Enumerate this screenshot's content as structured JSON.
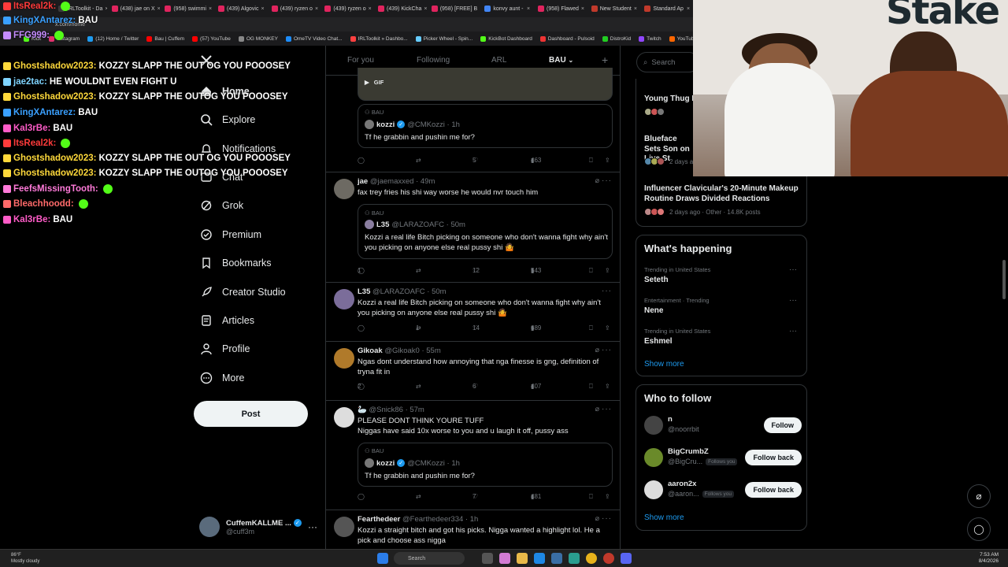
{
  "browser": {
    "tabs": [
      "IRLToolkit - Da",
      "(438) jae on X",
      "(958) swimmi",
      "(439) Algovic",
      "(439) ryzen o",
      "(439) ryzen o",
      "(439) KickCha",
      "(958) [FREE] B",
      "konvy aunt -",
      "(958) Flawed",
      "New Student",
      "Standard Ap"
    ],
    "address": "x.com/home",
    "bookmarks": [
      "Kick",
      "Instagram",
      "(12) Home / Twitter",
      "Bau | Cuffem",
      "(57) YouTube",
      "OG MONKEY",
      "OmeTV Video Chat...",
      "IRLToolkit » Dashbo...",
      "Picker Wheel - Spin...",
      "KickBot Dashboard",
      "Dashboard - Pulsoid",
      "DistroKid",
      "Twitch",
      "YouTube to WAV D..."
    ]
  },
  "chat": [
    {
      "user": "ItsReal2k:",
      "msg": "",
      "color": "#ff3b3b",
      "emote": true
    },
    {
      "user": "KingXAntarez:",
      "msg": "BAU",
      "color": "#3aa0ff"
    },
    {
      "user": "FFG999:",
      "msg": "",
      "color": "#c58cff"
    },
    {
      "user": "Ghostshadow2023:",
      "msg": "KOZZY SLAPP THE     OUT OG YOU POOOSEY",
      "color": "#ffd93b"
    },
    {
      "user": "jae2tac:",
      "msg": "HE WOULDNT EVEN FIGHT U",
      "color": "#7fd4ff"
    },
    {
      "user": "Ghostshadow2023:",
      "msg": "KOZZY SLAPP THE     OUTOG YOU POOOSEY",
      "color": "#ffd93b"
    },
    {
      "user": "KingXAntarez:",
      "msg": "BAU",
      "color": "#3aa0ff"
    },
    {
      "user": "Kal3rBe:",
      "msg": "BAU",
      "color": "#ff5cc8"
    },
    {
      "user": "ItsReal2k:",
      "msg": "",
      "color": "#ff3b3b"
    },
    {
      "user": "Ghostshadow2023:",
      "msg": "KOZZY SLAPP THE     OUT OG YOU POOOSEY",
      "color": "#ffd93b"
    },
    {
      "user": "Ghostshadow2023:",
      "msg": "KOZZY SLAPP THE     OUTOG YOU POOOSEY",
      "color": "#ffd93b"
    },
    {
      "user": "FeefsMissingTooth:",
      "msg": "",
      "color": "#ff7ad9"
    },
    {
      "user": "Bleachhoodd:",
      "msg": "",
      "color": "#ff6a6a"
    },
    {
      "user": "Kal3rBe:",
      "msg": "BAU",
      "color": "#ff5cc8"
    }
  ],
  "nav": {
    "items": [
      "Home",
      "Explore",
      "Notifications",
      "Chat",
      "Grok",
      "Premium",
      "Bookmarks",
      "Creator Studio",
      "Articles",
      "Profile",
      "More"
    ],
    "post_label": "Post",
    "account_name": "CuffemKALLME ...",
    "account_handle": "@cuff3m"
  },
  "feed": {
    "tabs": [
      "For you",
      "Following",
      "ARL",
      "BAU"
    ],
    "active_tab": "BAU",
    "gif_label": "GIF",
    "post0": {
      "quote_label": "BAU",
      "quote_name": "kozzi",
      "quote_handle": "@CMKozzi · 1h",
      "quote_text": "Tf he grabbin and pushin me for?",
      "replies": "",
      "retweets": "",
      "likes": "5",
      "views": "463"
    },
    "post1": {
      "name": "jae",
      "handle": "@jaemaxxed · 49m",
      "text": "fax trey fries his shi way worse he would nvr touch him",
      "quote_label": "BAU",
      "quote_name": "L35",
      "quote_handle": "@LARAZOAFC · 50m",
      "quote_text": "Kozzi a real life Bitch picking on someone who don't wanna fight why ain't you picking on anyone else real pussy shi 🤷",
      "replies": "1",
      "retweets": "",
      "likes": "12",
      "views": "543"
    },
    "post2": {
      "name": "L35",
      "handle": "@LARAZOAFC · 50m",
      "text": "Kozzi a real life Bitch picking on someone who don't wanna fight why ain't you picking on anyone else real pussy shi 🤷",
      "replies": "",
      "retweets": "1",
      "likes": "14",
      "views": "689"
    },
    "post3": {
      "name": "Gikoak",
      "handle": "@Gikoak0 · 55m",
      "text": "Ngas dont understand how annoying that nga finesse is gng, definition of tryna fit in",
      "replies": "2",
      "retweets": "",
      "likes": "6",
      "views": "407"
    },
    "post4": {
      "name": "",
      "handle": "@Snick86 · 57m",
      "text": "PLEASE DONT THINK YOURE TUFF\nNiggas have said 10x worse to you and u laugh it off, pussy ass",
      "quote_label": "BAU",
      "quote_name": "kozzi",
      "quote_handle": "@CMKozzi · 1h",
      "quote_text": "Tf he grabbin and pushin me for?",
      "replies": "",
      "retweets": "",
      "likes": "7",
      "views": "481"
    },
    "post5": {
      "name": "Fearthedeer",
      "handle": "@Fearthedeer334 · 1h",
      "text": "Kozzi a straight bitch and got his picks. Nigga wanted a highlight lol. He a pick and choose ass nigga"
    }
  },
  "right": {
    "search_placeholder": "Search",
    "news": [
      {
        "title": "Young Thug In",
        "meta": ""
      },
      {
        "title": "Blueface Sets Son on Live St",
        "meta": "2 days ago"
      },
      {
        "title": "Influencer Clavicular's 20-Minute Makeup Routine Draws Divided Reactions",
        "meta": "2 days ago · Other · 14.8K posts"
      }
    ],
    "happening_title": "What's happening",
    "trends": [
      {
        "context": "Trending in United States",
        "name": "Seteth"
      },
      {
        "context": "Entertainment · Trending",
        "name": "Nene"
      },
      {
        "context": "Trending in United States",
        "name": "Eshmel"
      }
    ],
    "show_more": "Show more",
    "wtf_title": "Who to follow",
    "who_to_follow": [
      {
        "name": "n",
        "handle": "@noorrbit",
        "follows_you": "",
        "button": "Follow"
      },
      {
        "name": "BigCrumbZ",
        "handle": "@BigCru...",
        "follows_you": "Follows you",
        "button": "Follow back"
      },
      {
        "name": "aaron2x",
        "handle": "@aaron...",
        "follows_you": "Follows you",
        "button": "Follow back"
      }
    ],
    "show_more2": "Show more"
  },
  "taskbar": {
    "weather_temp": "86°F",
    "weather_desc": "Mostly cloudy",
    "search_label": "Search",
    "time": "7:53 AM",
    "date": "8/4/2026"
  },
  "cam": {
    "logo": "Stake"
  },
  "colors": {
    "accent": "#1d9bf0",
    "background": "#000000",
    "border": "#2f3336",
    "muted": "#71767b"
  }
}
